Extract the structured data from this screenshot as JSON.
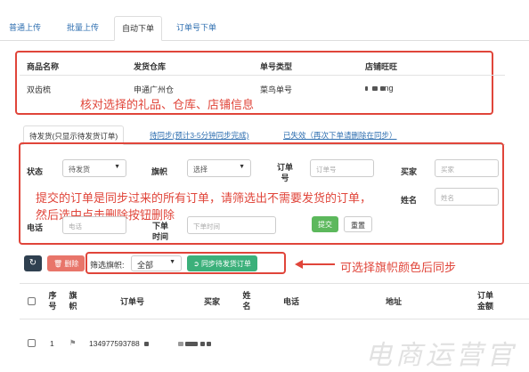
{
  "top_tabs": [
    "普通上传",
    "批量上传",
    "自动下单",
    "订单号下单"
  ],
  "info_table": {
    "headers": [
      "商品名称",
      "发货仓库",
      "单号类型",
      "店铺旺旺"
    ],
    "row": [
      "双齿梳",
      "申通广州仓",
      "菜鸟单号",
      "ng"
    ]
  },
  "annotation_1": "核对选择的礼品、仓库、店铺信息",
  "sub_tabs": [
    "待发货(只显示待发货订单)",
    "待同步(预计3-5分钟同步完成)",
    "已失效（再次下单请删除在同步）"
  ],
  "filters": {
    "status_label": "状态",
    "status_value": "待发货",
    "flag_label": "旗帜",
    "flag_value": "选择",
    "order_label": "订单号",
    "order_placeholder": "订单号",
    "buyer_label": "买家",
    "buyer_placeholder": "买家",
    "name_label": "姓名",
    "name_placeholder": "姓名",
    "phone_label": "电话",
    "phone_placeholder": "电话",
    "time_label": "下单时间",
    "time_placeholder": "下单时间",
    "submit": "提交",
    "reset": "重置"
  },
  "annotation_2_line1": "提交的订单是同步过来的所有订单，请筛选出不需要发货的订单，",
  "annotation_2_line2": "然后选中点击删除按钮删除",
  "toolbar": {
    "refresh_icon": "refresh-icon",
    "delete_label": "删除",
    "flag_filter_label": "筛选旗帜:",
    "flag_filter_value": "全部",
    "sync_label": "同步待发货订单"
  },
  "annotation_3": "可选择旗帜颜色后同步",
  "order_table": {
    "headers": [
      "序号",
      "旗帜",
      "订单号",
      "买家",
      "姓名",
      "电话",
      "地址",
      "订单金额"
    ],
    "rows": [
      {
        "index": "1",
        "order_no": "134977593788"
      }
    ]
  },
  "watermark": "电商运营官",
  "colors": {
    "accent_red": "#e0453a",
    "link_blue": "#2f6fb0",
    "green": "#5cb85c",
    "teal": "#3bb07a"
  }
}
